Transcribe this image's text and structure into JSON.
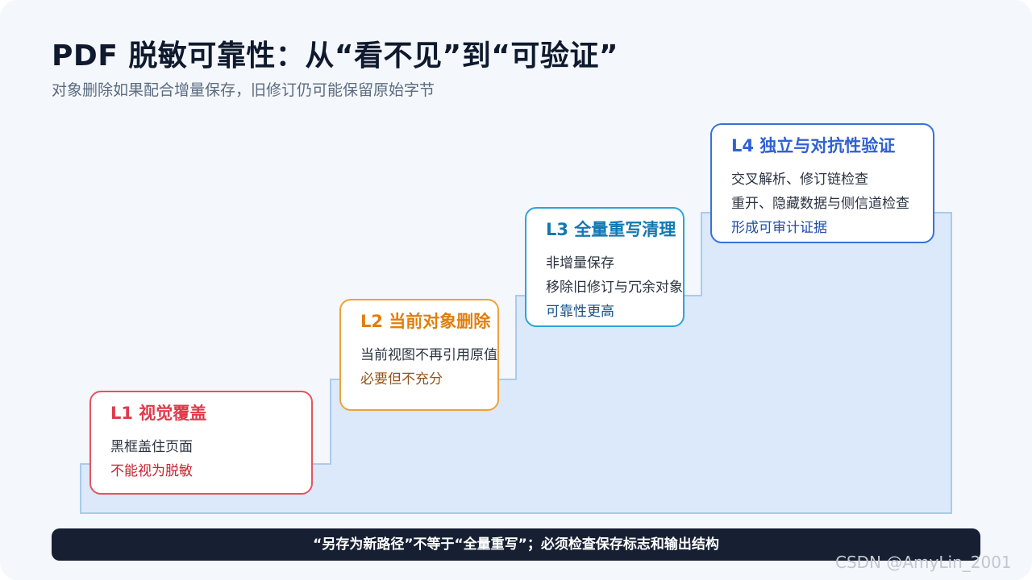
{
  "title": "PDF 脱敏可靠性：从“看不见”到“可验证”",
  "subtitle": "对象删除如果配合增量保存，旧修订仍可能保留原始字节",
  "levels": [
    {
      "title": "L1 视觉覆盖",
      "lines": [
        "黑框盖住页面"
      ],
      "accent": "不能视为脱敏",
      "color": "#e03a4b"
    },
    {
      "title": "L2 当前对象删除",
      "lines": [
        "当前视图不再引用原值"
      ],
      "accent": "必要但不充分",
      "color": "#e07f0d"
    },
    {
      "title": "L3 全量重写清理",
      "lines": [
        "非增量保存",
        "移除旧修订与冗余对象"
      ],
      "accent": "可靠性更高",
      "color": "#1178b3"
    },
    {
      "title": "L4 独立与对抗性验证",
      "lines": [
        "交叉解析、修订链检查",
        "重开、隐藏数据与侧信道检查"
      ],
      "accent": "形成可审计证据",
      "color": "#2f61d4"
    }
  ],
  "banner": "“另存为新路径”不等于“全量重写”；必须检查保存标志和输出结构",
  "watermark": "CSDN @AmyLin_2001",
  "colors": {
    "stairs_fill": "#dce9fb",
    "stairs_stroke": "#a9cbec",
    "banner_bg": "#172033"
  }
}
